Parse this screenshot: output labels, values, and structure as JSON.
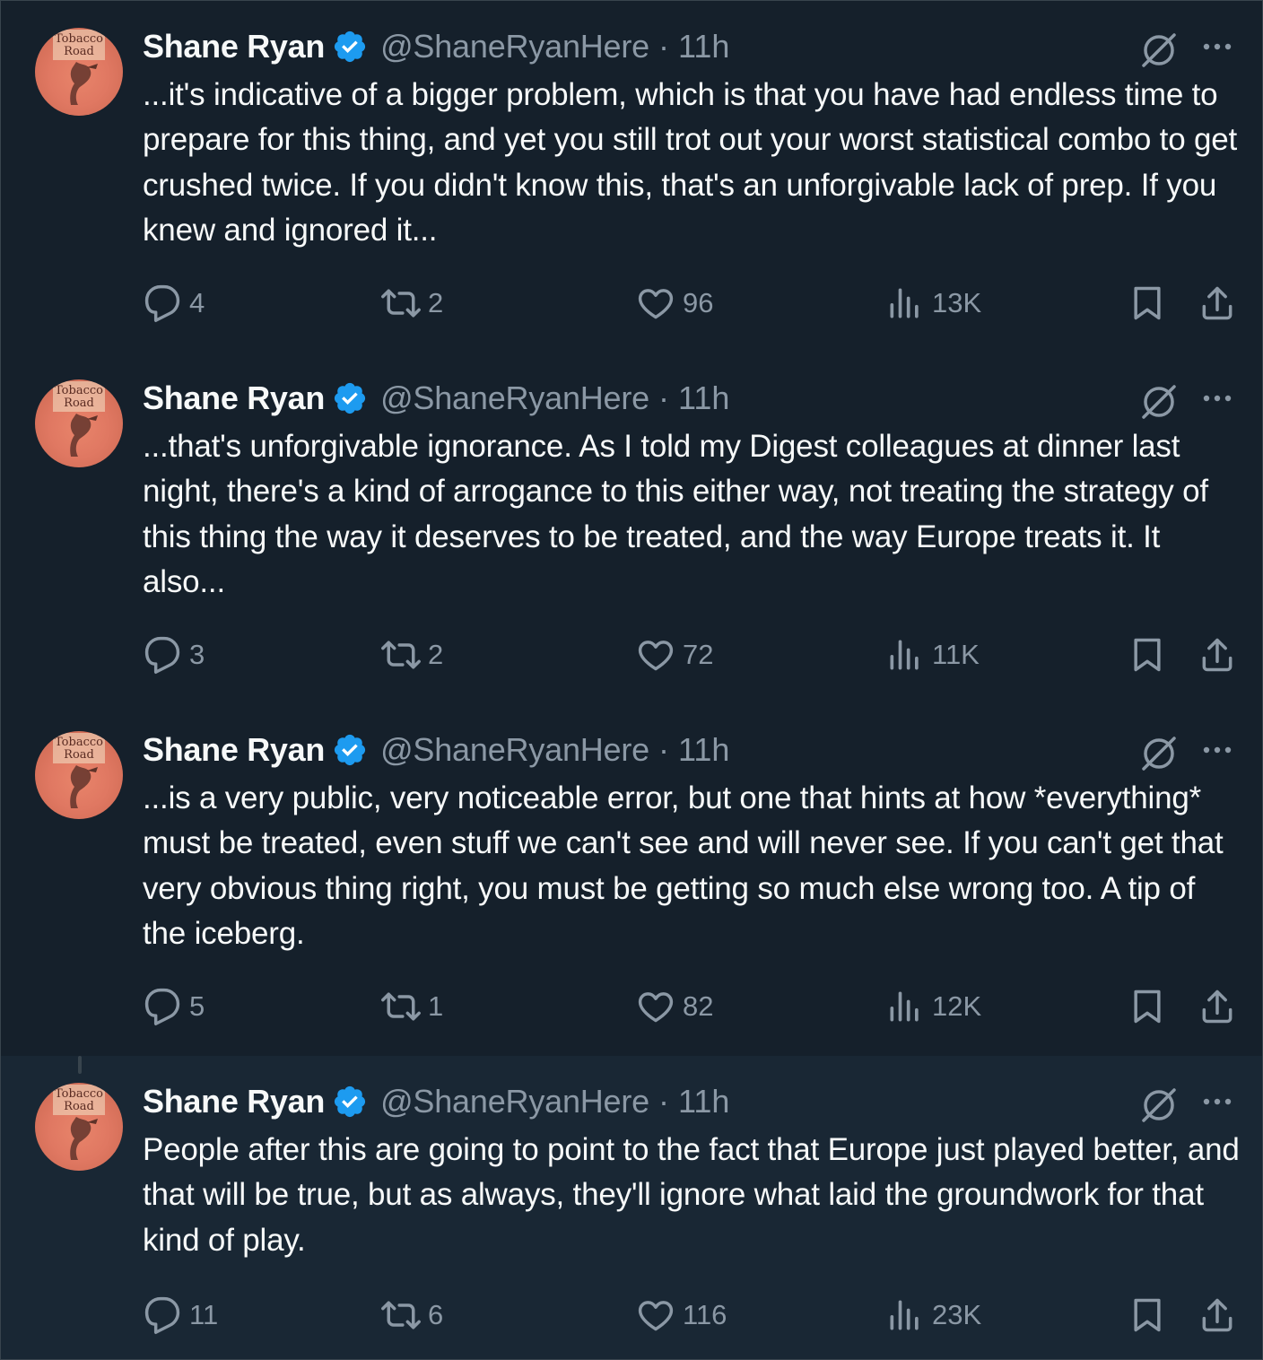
{
  "author": {
    "name": "Shane Ryan",
    "handle": "@ShaneRyanHere",
    "separator": "·",
    "avatar_text_line1": "Tobacco",
    "avatar_text_line2": "Road"
  },
  "tweets": [
    {
      "time": "11h",
      "text": "...it's indicative of a bigger problem, which is that you have had endless time to prepare for this thing, and yet you still trot out your worst statistical combo to get crushed twice. If you didn't know this, that's an unforgivable lack of prep. If you knew and ignored it...",
      "replies": "4",
      "reposts": "2",
      "likes": "96",
      "views": "13K"
    },
    {
      "time": "11h",
      "text": "...that's unforgivable ignorance. As I told my Digest colleagues at dinner last night, there's a kind of arrogance to this either way, not treating the strategy of this thing the way it deserves to be treated, and the way Europe treats it. It also...",
      "replies": "3",
      "reposts": "2",
      "likes": "72",
      "views": "11K"
    },
    {
      "time": "11h",
      "text": "...is a very public, very noticeable error, but one that hints at how *everything* must be treated, even stuff we can't see and will never see. If you can't get that very obvious thing right, you must be getting so much else wrong too. A tip of the iceberg.",
      "replies": "5",
      "reposts": "1",
      "likes": "82",
      "views": "12K"
    },
    {
      "time": "11h",
      "text": "People after this are going to point to the fact that Europe just played better, and that will be true, but as always, they'll ignore what laid the groundwork for that kind of play.",
      "replies": "11",
      "reposts": "6",
      "likes": "116",
      "views": "23K"
    }
  ],
  "colors": {
    "background": "#15202b",
    "highlight_background": "#192734",
    "text_primary": "#f7f9f9",
    "text_secondary": "#8b98a5",
    "verified_blue": "#1d9bf0",
    "thread_line": "#38444d"
  },
  "icons": [
    "verified-badge-icon",
    "grok-icon",
    "more-icon",
    "reply-icon",
    "repost-icon",
    "like-icon",
    "views-icon",
    "bookmark-icon",
    "share-icon"
  ]
}
